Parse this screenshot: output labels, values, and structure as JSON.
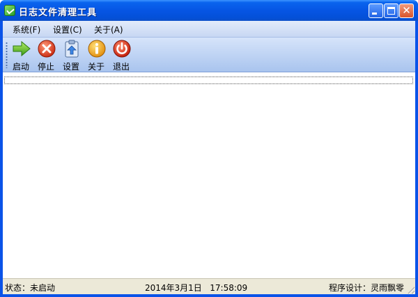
{
  "window": {
    "title": "日志文件清理工具",
    "icons": {
      "app": "app-icon",
      "minimize": "minimize-icon",
      "maximize": "maximize-icon",
      "close": "close-icon"
    }
  },
  "menu": {
    "items": [
      {
        "label": "系统(F)"
      },
      {
        "label": "设置(C)"
      },
      {
        "label": "关于(A)"
      }
    ]
  },
  "toolbar": {
    "items": [
      {
        "label": "启动",
        "icon": "arrow-right-icon"
      },
      {
        "label": "停止",
        "icon": "stop-icon"
      },
      {
        "label": "设置",
        "icon": "clipboard-settings-icon"
      },
      {
        "label": "关于",
        "icon": "info-icon"
      },
      {
        "label": "退出",
        "icon": "power-icon"
      }
    ]
  },
  "status": {
    "state": "状态：未启动",
    "datetime": "2014年3月1日   17:58:09",
    "credit": "程序设计：灵雨飘零"
  },
  "colors": {
    "titlebar": "#0655e4",
    "toolbar": "#a9c4ee",
    "statusbar": "#ece9d8"
  }
}
